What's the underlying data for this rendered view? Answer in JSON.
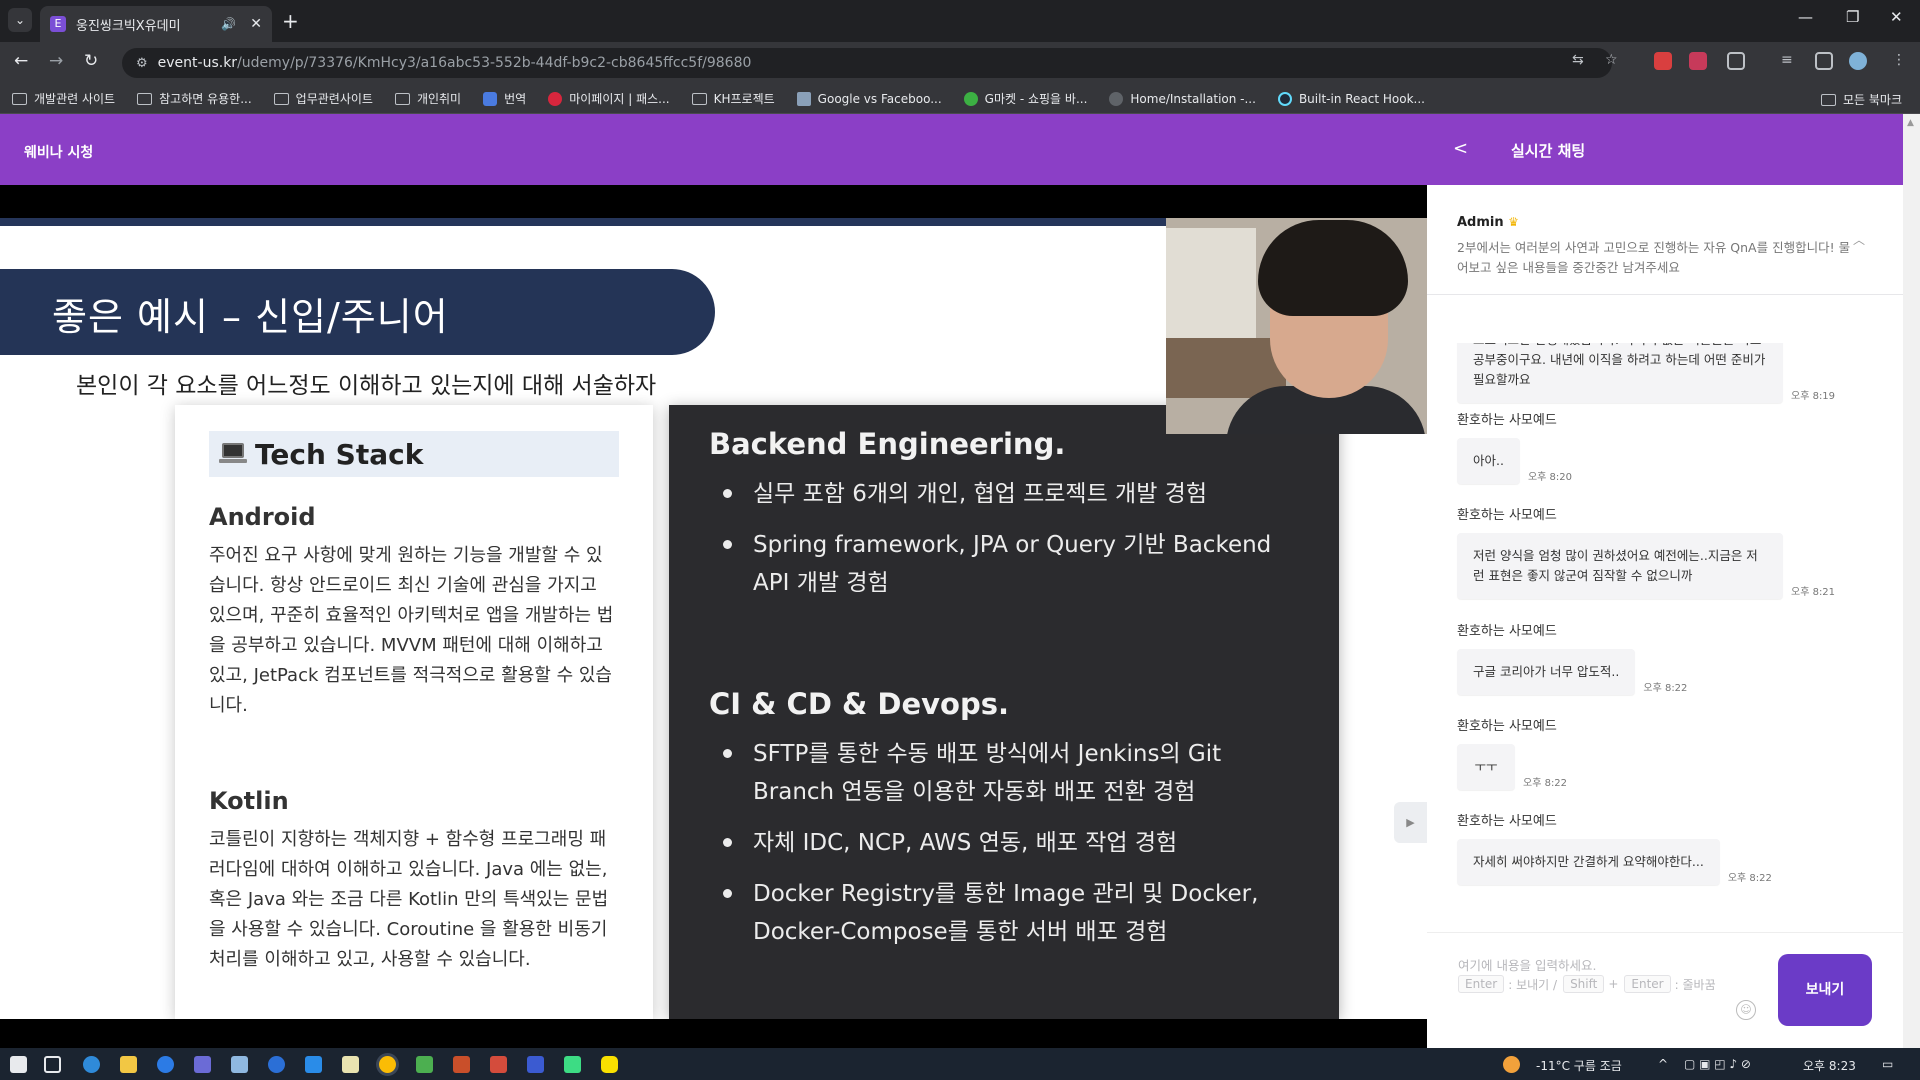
{
  "browser": {
    "tab_title": "웅진씽크빅X유데미",
    "url_host": "event-us.kr",
    "url_path": "/udemy/p/73376/KmHcy3/a16abc53-552b-44df-b9c2-cb8645ffcc5f/98680",
    "bookmarks": [
      {
        "label": "개발관련 사이트",
        "icon": "folder-icon"
      },
      {
        "label": "참고하면 유용한...",
        "icon": "folder-icon"
      },
      {
        "label": "업무관련사이트",
        "icon": "folder-icon"
      },
      {
        "label": "개인취미",
        "icon": "folder-icon"
      },
      {
        "label": "번역",
        "icon": "translate-icon"
      },
      {
        "label": "마이페이지 | 패스...",
        "icon": "red-circle-icon"
      },
      {
        "label": "KH프로젝트",
        "icon": "folder-icon"
      },
      {
        "label": "Google vs Faceboo...",
        "icon": "chart-icon"
      },
      {
        "label": "G마켓 - 쇼핑을 바...",
        "icon": "gmarket-icon"
      },
      {
        "label": "Home/Installation -...",
        "icon": "gear-icon"
      },
      {
        "label": "Built-in React Hook...",
        "icon": "react-icon"
      }
    ],
    "all_bookmarks": "모든 북마크"
  },
  "page": {
    "header_title": "웨비나 시청"
  },
  "slide": {
    "title": "좋은 예시 – 신입/주니어",
    "subtitle": "본인이 각 요소를 어느정도 이해하고 있는지에 대해 서술하자",
    "left_card": {
      "heading": "Tech Stack",
      "sections": [
        {
          "title": "Android",
          "body": "주어진 요구 사항에 맞게 원하는 기능을 개발할 수 있습니다. 항상 안드로이드 최신 기술에 관심을 가지고 있으며, 꾸준히 효율적인 아키텍처로 앱을 개발하는 법을 공부하고 있습니다. MVVM 패턴에 대해 이해하고 있고, JetPack 컴포넌트를 적극적으로 활용할 수 있습니다."
        },
        {
          "title": "Kotlin",
          "body": "코틀린이 지향하는 객체지향 + 함수형 프로그래밍 패러다임에 대하여 이해하고 있습니다. Java 에는 없는, 혹은 Java 와는 조금 다른 Kotlin 만의 특색있는 문법을 사용할 수 있습니다. Coroutine 을 활용한 비동기 처리를 이해하고 있고, 사용할 수 있습니다."
        }
      ]
    },
    "right_card": {
      "sections": [
        {
          "title": "Backend Engineering.",
          "items": [
            "실무 포함 6개의 개인, 협업 프로젝트 개발 경험",
            "Spring framework, JPA or Query 기반 Backend API 개발 경험"
          ]
        },
        {
          "title": "CI & CD & Devops.",
          "items": [
            "SFTP를 통한 수동 배포 방식에서 Jenkins의 Git Branch 연동을 이용한 자동화 배포 전환 경험",
            "자체 IDC, NCP, AWS 연동, 배포 작업 경험",
            "Docker Registry를 통한 Image 관리 및 Docker, Docker-Compose를 통한 서버 배포 경험"
          ]
        }
      ]
    }
  },
  "chat": {
    "title": "실시간 채팅",
    "notice": {
      "user": "Admin",
      "text": "2부에서는 여러분의 사연과 고민으로 진행하는 자유 QnA를 진행합니다! 물어보고 싶은 내용들을 중간중간 남겨주세요"
    },
    "messages": [
      {
        "user": "",
        "text": "프로젝트만 진행해왔습니다. 나머지 없는 기술들을 따로 공부중이구요. 내년에 이직을 하려고 하는데 어떤 준비가 필요할까요",
        "time": "오후 8:19"
      },
      {
        "user": "환호하는 사모예드",
        "text": "아아..",
        "time": "오후 8:20"
      },
      {
        "user": "환호하는 사모예드",
        "text": "저런 양식을 엄청 많이 권하셨어요 예전에는..지금은 저런 표현은 좋지 않군여 짐작할 수 없으니까",
        "time": "오후 8:21"
      },
      {
        "user": "환호하는 사모예드",
        "text": "구글 코리아가 너무 압도적..",
        "time": "오후 8:22"
      },
      {
        "user": "환호하는 사모예드",
        "text": "ㅜㅜ",
        "time": "오후 8:22"
      },
      {
        "user": "환호하는 사모예드",
        "text": "자세히 써야하지만 간결하게 요약해야한다...",
        "time": "오후 8:22"
      }
    ],
    "input_placeholder": "여기에 내용을 입력하세요.",
    "hint_enter": "Enter",
    "hint_send": ": 보내기 /",
    "hint_shift": "Shift",
    "hint_plus": "+",
    "hint_enter2": "Enter",
    "hint_newline": ": 줄바꿈",
    "send_label": "보내기"
  },
  "taskbar": {
    "weather": "-11°C  구름 조금",
    "clock": "오후 8:23"
  }
}
